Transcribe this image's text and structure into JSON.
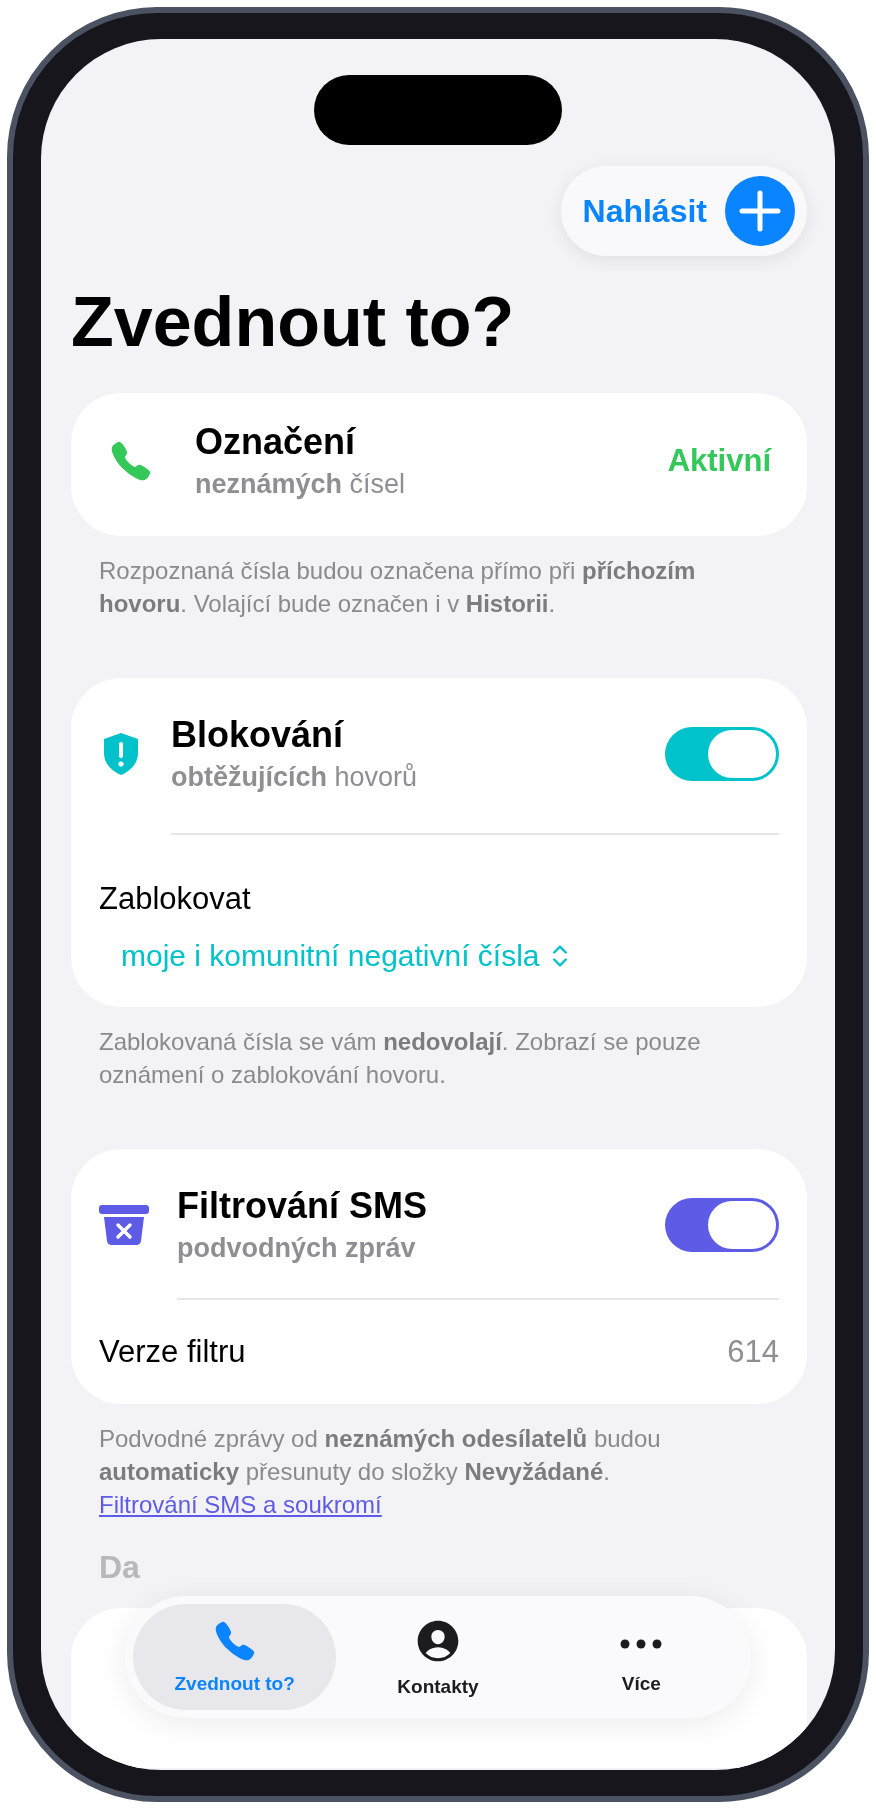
{
  "report_button": {
    "label": "Nahlásit"
  },
  "title": "Zvednout to?",
  "sections": [
    {
      "kind": "status",
      "color": "#34c759",
      "title": "Označení",
      "subtitle": "**neznámých** čísel",
      "status": "Aktivní",
      "footer": "Rozpoznaná čísla budou označena přímo při **příchozím hovoru**. Volající bude označen i v **Historii**."
    },
    {
      "kind": "toggle",
      "color": "#00c2cb",
      "title": "Blokování",
      "subtitle": "**obtěžujících** hovorů",
      "on": true,
      "picker": {
        "label": "Zablokovat",
        "value": "moje i komunitní negativní čísla"
      },
      "footer": "Zablokovaná čísla se vám **nedovolají**. Zobrazí se pouze oznámení o zablokování hovoru."
    },
    {
      "kind": "toggle",
      "color": "#5e5ce6",
      "title": "Filtrování SMS",
      "subtitle": "**podvodných zpráv**",
      "on": true,
      "row": {
        "label": "Verze filtru",
        "value": "614"
      },
      "footer": "Podvodné zprávy od **neznámých odesílatelů** budou **automaticky** přesunuty do složky **Nevyžádané**.",
      "link": "Filtrování SMS a soukromí"
    }
  ],
  "partial_heading": "Da",
  "tabs": [
    {
      "label": "Zvednout to?",
      "selected": true
    },
    {
      "label": "Kontakty",
      "selected": false
    },
    {
      "label": "Více",
      "selected": false
    }
  ]
}
